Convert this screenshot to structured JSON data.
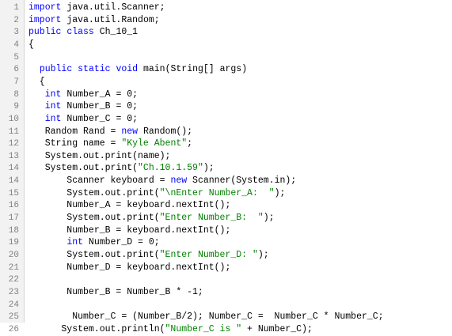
{
  "editor": {
    "language": "java",
    "colors": {
      "keyword": "#0000ff",
      "string": "#008000",
      "text": "#000000",
      "line_number": "#808080",
      "background": "#ffffff"
    },
    "lines": [
      {
        "n": "1",
        "tokens": [
          {
            "t": "kw",
            "v": "import"
          },
          {
            "t": "tx",
            "v": " java.util.Scanner;"
          }
        ]
      },
      {
        "n": "2",
        "tokens": [
          {
            "t": "kw",
            "v": "import"
          },
          {
            "t": "tx",
            "v": " java.util.Random;"
          }
        ]
      },
      {
        "n": "3",
        "tokens": [
          {
            "t": "kw",
            "v": "public"
          },
          {
            "t": "tx",
            "v": " "
          },
          {
            "t": "kw",
            "v": "class"
          },
          {
            "t": "tx",
            "v": " Ch_10_1"
          }
        ]
      },
      {
        "n": "4",
        "tokens": [
          {
            "t": "tx",
            "v": "{"
          }
        ]
      },
      {
        "n": "5",
        "tokens": []
      },
      {
        "n": "6",
        "tokens": [
          {
            "t": "tx",
            "v": "  "
          },
          {
            "t": "kw",
            "v": "public"
          },
          {
            "t": "tx",
            "v": " "
          },
          {
            "t": "kw",
            "v": "static"
          },
          {
            "t": "tx",
            "v": " "
          },
          {
            "t": "kw",
            "v": "void"
          },
          {
            "t": "tx",
            "v": " main(String[] args)"
          }
        ]
      },
      {
        "n": "7",
        "tokens": [
          {
            "t": "tx",
            "v": "  {"
          }
        ]
      },
      {
        "n": "8",
        "tokens": [
          {
            "t": "tx",
            "v": "   "
          },
          {
            "t": "kw",
            "v": "int"
          },
          {
            "t": "tx",
            "v": " Number_A = 0;"
          }
        ]
      },
      {
        "n": "9",
        "tokens": [
          {
            "t": "tx",
            "v": "   "
          },
          {
            "t": "kw",
            "v": "int"
          },
          {
            "t": "tx",
            "v": " Number_B = 0;"
          }
        ]
      },
      {
        "n": "10",
        "tokens": [
          {
            "t": "tx",
            "v": "   "
          },
          {
            "t": "kw",
            "v": "int"
          },
          {
            "t": "tx",
            "v": " Number_C = 0;"
          }
        ]
      },
      {
        "n": "11",
        "tokens": [
          {
            "t": "tx",
            "v": "   Random Rand = "
          },
          {
            "t": "kw",
            "v": "new"
          },
          {
            "t": "tx",
            "v": " Random();"
          }
        ]
      },
      {
        "n": "12",
        "tokens": [
          {
            "t": "tx",
            "v": "   String name = "
          },
          {
            "t": "str",
            "v": "\"Kyle Abent\""
          },
          {
            "t": "tx",
            "v": ";"
          }
        ]
      },
      {
        "n": "13",
        "tokens": [
          {
            "t": "tx",
            "v": "   System.out.print(name);"
          }
        ]
      },
      {
        "n": "14",
        "tokens": [
          {
            "t": "tx",
            "v": "   System.out.print("
          },
          {
            "t": "str",
            "v": "\"Ch.10.1.59\""
          },
          {
            "t": "tx",
            "v": ");"
          }
        ]
      },
      {
        "n": "14",
        "tokens": [
          {
            "t": "tx",
            "v": "       Scanner keyboard = "
          },
          {
            "t": "kw",
            "v": "new"
          },
          {
            "t": "tx",
            "v": " Scanner(System.in);"
          }
        ]
      },
      {
        "n": "15",
        "tokens": [
          {
            "t": "tx",
            "v": "       System.out.print("
          },
          {
            "t": "str",
            "v": "\"\\nEnter Number_A:  \""
          },
          {
            "t": "tx",
            "v": ");"
          }
        ]
      },
      {
        "n": "16",
        "tokens": [
          {
            "t": "tx",
            "v": "       Number_A = keyboard.nextInt();"
          }
        ]
      },
      {
        "n": "17",
        "tokens": [
          {
            "t": "tx",
            "v": "       System.out.print("
          },
          {
            "t": "str",
            "v": "\"Enter Number_B:  \""
          },
          {
            "t": "tx",
            "v": ");"
          }
        ]
      },
      {
        "n": "18",
        "tokens": [
          {
            "t": "tx",
            "v": "       Number_B = keyboard.nextInt();"
          }
        ]
      },
      {
        "n": "19",
        "tokens": [
          {
            "t": "tx",
            "v": "       "
          },
          {
            "t": "kw",
            "v": "int"
          },
          {
            "t": "tx",
            "v": " Number_D = 0;"
          }
        ]
      },
      {
        "n": "20",
        "tokens": [
          {
            "t": "tx",
            "v": "       System.out.print("
          },
          {
            "t": "str",
            "v": "\"Enter Number_D: \""
          },
          {
            "t": "tx",
            "v": ");"
          }
        ]
      },
      {
        "n": "21",
        "tokens": [
          {
            "t": "tx",
            "v": "       Number_D = keyboard.nextInt();"
          }
        ]
      },
      {
        "n": "22",
        "tokens": []
      },
      {
        "n": "23",
        "tokens": [
          {
            "t": "tx",
            "v": "       Number_B = Number_B * -1;"
          }
        ]
      },
      {
        "n": "24",
        "tokens": []
      },
      {
        "n": "25",
        "tokens": [
          {
            "t": "tx",
            "v": "        Number_C = (Number_B/2); Number_C =  Number_C * Number_C;"
          }
        ]
      },
      {
        "n": "26",
        "tokens": [
          {
            "t": "tx",
            "v": "      System.out.println("
          },
          {
            "t": "str",
            "v": "\"Number_C is \""
          },
          {
            "t": "tx",
            "v": " + Number_C);"
          }
        ]
      }
    ]
  }
}
